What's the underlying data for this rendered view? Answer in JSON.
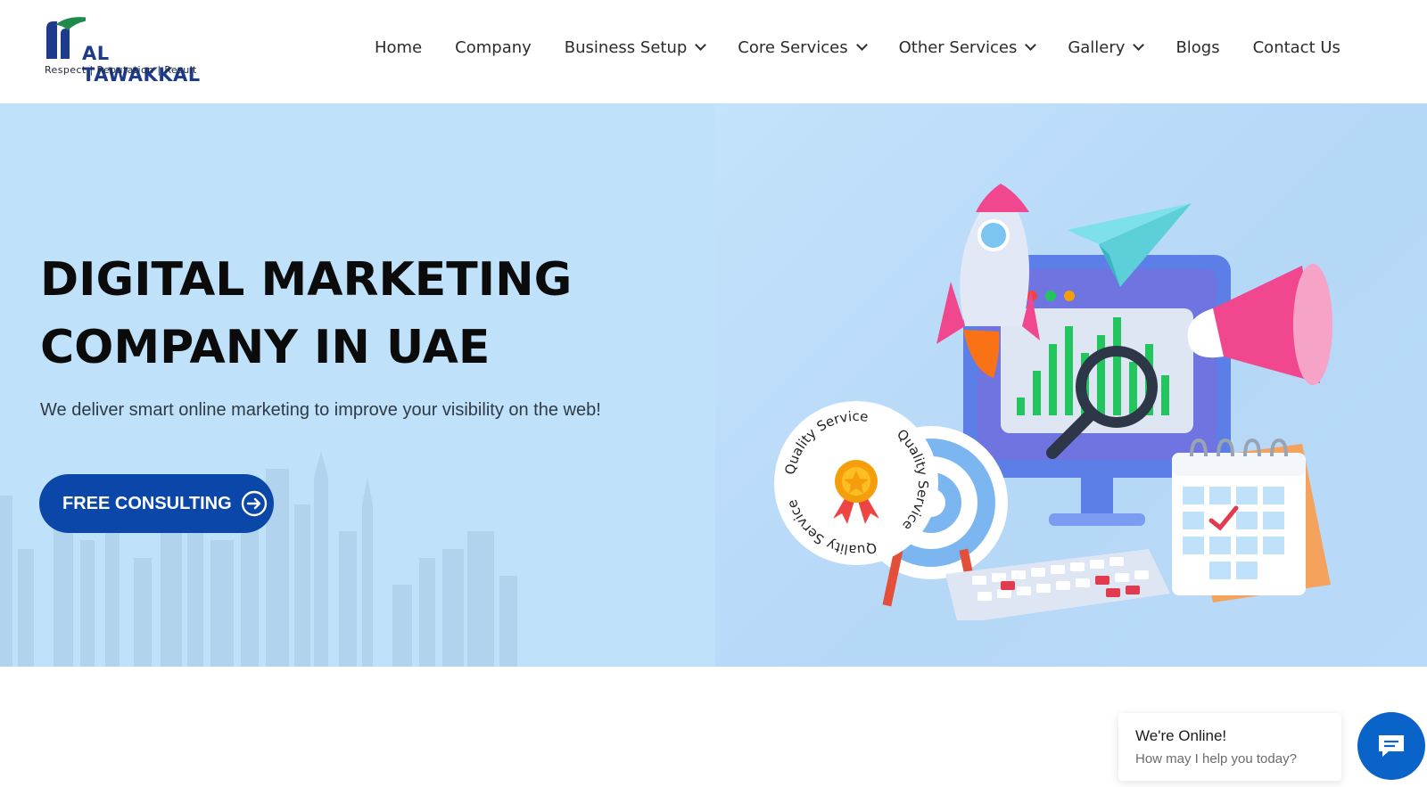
{
  "header": {
    "logo": {
      "name": "AL TAWAKKAL",
      "tagline": "Respect  | Reputation | Result"
    },
    "nav": [
      {
        "label": "Home",
        "dropdown": false
      },
      {
        "label": "Company",
        "dropdown": false
      },
      {
        "label": "Business Setup",
        "dropdown": true
      },
      {
        "label": "Core Services",
        "dropdown": true
      },
      {
        "label": "Other Services",
        "dropdown": true
      },
      {
        "label": "Gallery",
        "dropdown": true
      },
      {
        "label": "Blogs",
        "dropdown": false
      },
      {
        "label": "Contact Us",
        "dropdown": false
      }
    ]
  },
  "hero": {
    "title_line1": "DIGITAL MARKETING",
    "title_line2": "COMPANY IN UAE",
    "subtitle": "We deliver smart online marketing to improve your visibility on the web!",
    "cta_label": "FREE CONSULTING",
    "badge_text": "Quality Service"
  },
  "chat": {
    "title": "We're Online!",
    "subtitle": "How may I help you today?"
  },
  "colors": {
    "primary": "#0a47a8",
    "hero_bg": "#bfe1fa",
    "logo_blue": "#1e3a8a",
    "logo_green": "#1f8a4c",
    "chat_blue": "#0a63c9"
  },
  "icons": [
    "logo-mark",
    "chevron-down-icon",
    "arrow-right-circle-icon",
    "chat-icon"
  ]
}
